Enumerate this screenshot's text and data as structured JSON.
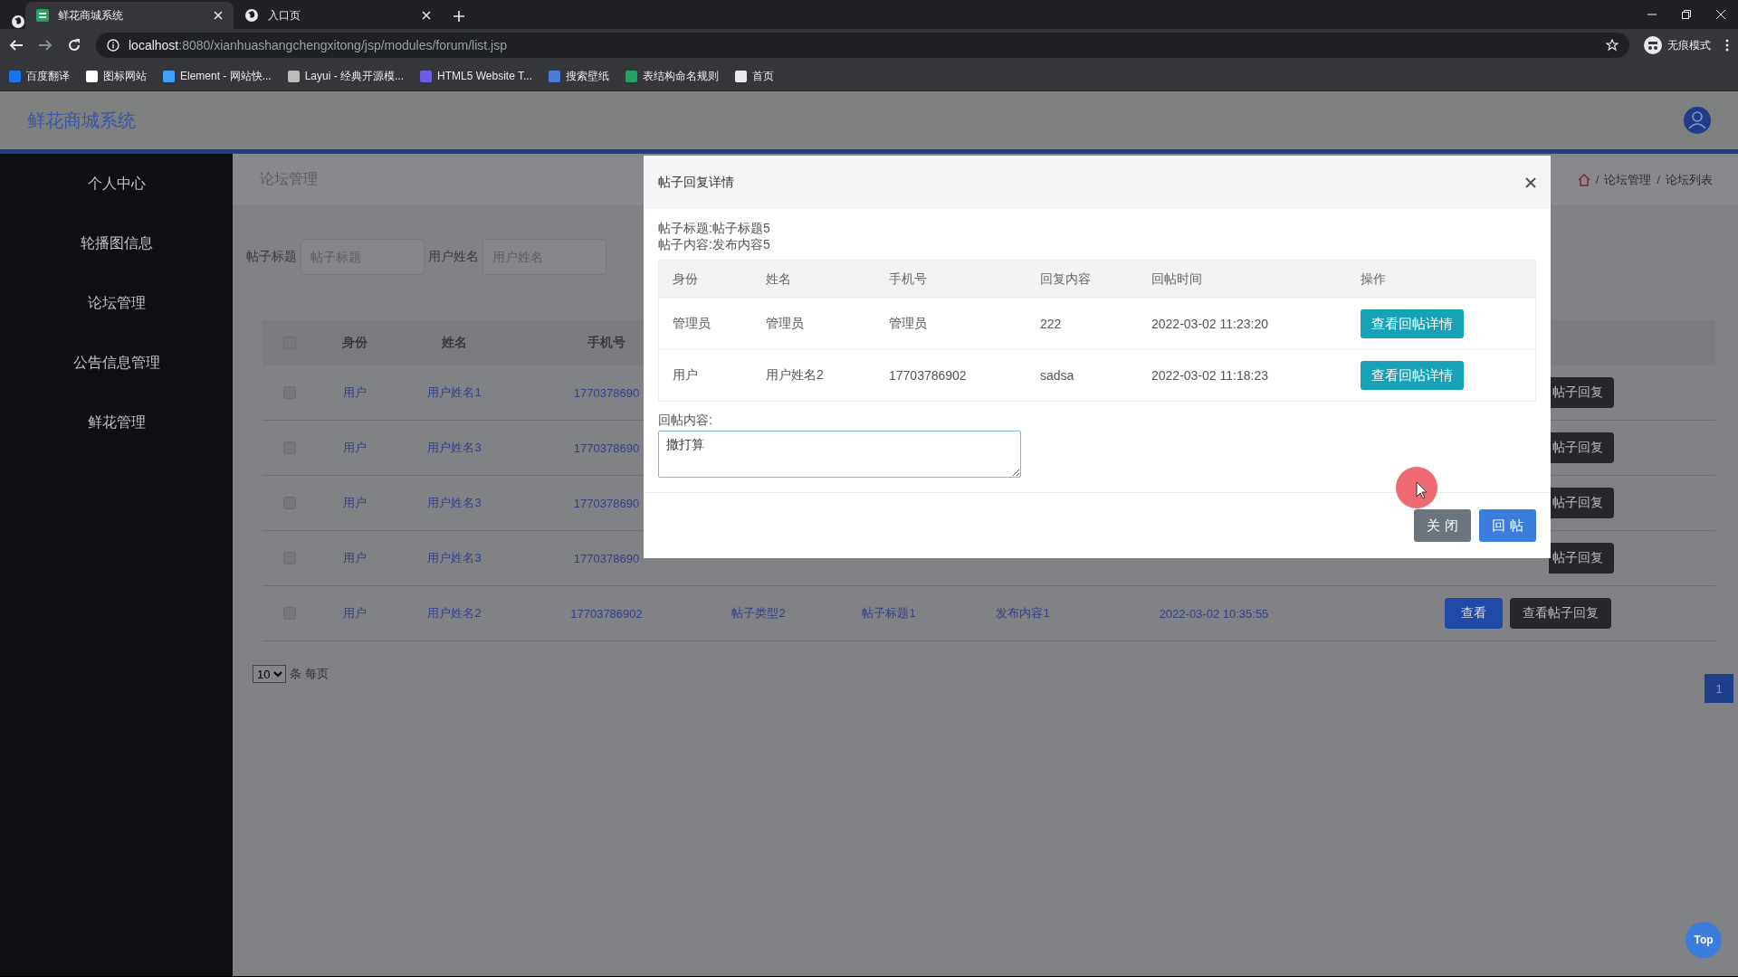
{
  "browser": {
    "tabs": [
      {
        "title": "鲜花商城系统",
        "selected": true
      },
      {
        "title": "入口页",
        "selected": false
      }
    ],
    "url_host": "localhost",
    "url_rest": ":8080/xianhuashangchengxitong/jsp/modules/forum/list.jsp",
    "profile": "无痕模式",
    "bookmarks": [
      {
        "label": "百度翻译",
        "color": "#1a73e8"
      },
      {
        "label": "图标网站",
        "color": "#ffffff"
      },
      {
        "label": "Element - 网站快...",
        "color": "#409eff"
      },
      {
        "label": "Layui - 经典开源模...",
        "color": "#bbbbbb"
      },
      {
        "label": "HTML5 Website T...",
        "color": "#6c5ce7"
      },
      {
        "label": "搜索壁纸",
        "color": "#4a7bd8"
      },
      {
        "label": "表结构命名规则",
        "color": "#21a366"
      },
      {
        "label": "首页",
        "color": "#e8eaed"
      }
    ]
  },
  "app": {
    "title": "鲜花商城系统"
  },
  "sidebar": {
    "items": [
      "个人中心",
      "轮播图信息",
      "论坛管理",
      "公告信息管理",
      "鲜花管理"
    ]
  },
  "page": {
    "heading": "论坛管理",
    "separator": "/",
    "breadcrumb": [
      "论坛管理",
      "论坛列表"
    ]
  },
  "filters": [
    {
      "label": "帖子标题",
      "placeholder": "帖子标题"
    },
    {
      "label": "用户姓名",
      "placeholder": "用户姓名"
    }
  ],
  "table": {
    "header_checked": false,
    "columns": [
      "身份",
      "姓名",
      "手机号"
    ],
    "rows": [
      {
        "checked": false,
        "cells": [
          "用户",
          "用户姓名1",
          "1770378690"
        ],
        "reply_button": "帖子回复"
      },
      {
        "checked": false,
        "cells": [
          "用户",
          "用户姓名3",
          "1770378690"
        ],
        "reply_button": "帖子回复"
      },
      {
        "checked": false,
        "cells": [
          "用户",
          "用户姓名3",
          "1770378690"
        ],
        "reply_button": "帖子回复"
      },
      {
        "checked": false,
        "cells": [
          "用户",
          "用户姓名3",
          "1770378690"
        ],
        "reply_button": "帖子回复"
      },
      {
        "checked": false,
        "cells": [
          "用户",
          "用户姓名2",
          "17703786902",
          "帖子类型2",
          "帖子标题1",
          "发布内容1",
          "2022-03-02 10:35:55"
        ],
        "view_button": "查看",
        "reply_button": "查看帖子回复"
      }
    ]
  },
  "page_size": "10",
  "page_size_suffix": "条 每页",
  "pages": [
    {
      "label": "1",
      "selected": true
    }
  ],
  "top_button": "Top",
  "dialog": {
    "title": "帖子回复详情",
    "post_title": "帖子标题:帖子标题5",
    "post_content": "帖子内容:发布内容5",
    "columns": [
      "身份",
      "姓名",
      "手机号",
      "回复内容",
      "回帖时间",
      "操作"
    ],
    "rows": [
      {
        "cells": [
          "管理员",
          "管理员",
          "管理员",
          "222",
          "2022-03-02 11:23:20"
        ],
        "button": "查看回帖详情"
      },
      {
        "cells": [
          "用户",
          "用户姓名2",
          "17703786902",
          "sadsa",
          "2022-03-02 11:18:23"
        ],
        "button": "查看回帖详情"
      }
    ],
    "reply_label": "回帖内容:",
    "reply_value": "撒打算",
    "buttons": [
      {
        "label": "关 闭",
        "kind": "secondary"
      },
      {
        "label": "回 帖",
        "kind": "primary"
      }
    ]
  }
}
